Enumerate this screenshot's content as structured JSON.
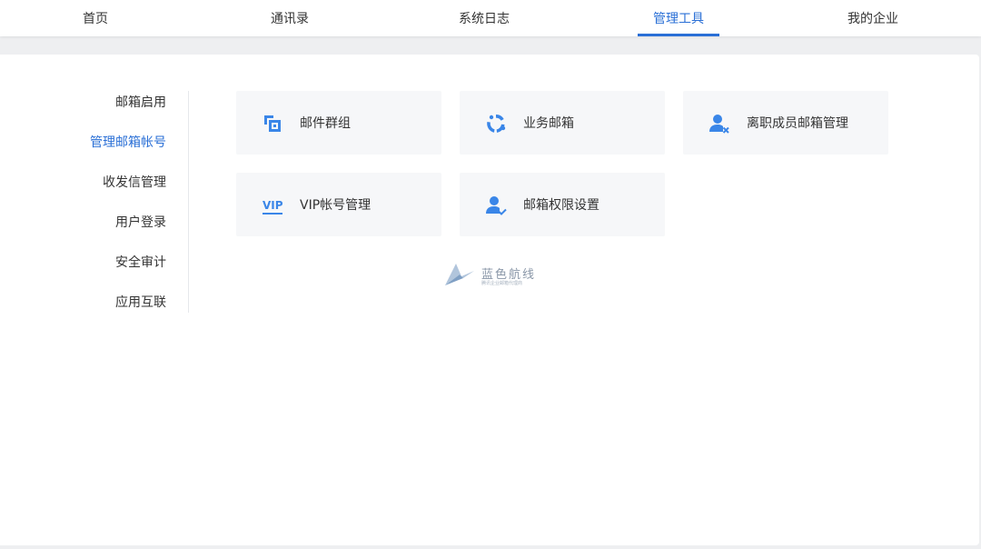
{
  "topnav": {
    "items": [
      {
        "label": "首页"
      },
      {
        "label": "通讯录"
      },
      {
        "label": "系统日志"
      },
      {
        "label": "管理工具",
        "active": true
      },
      {
        "label": "我的企业"
      }
    ]
  },
  "sidebar": {
    "items": [
      {
        "label": "邮箱启用"
      },
      {
        "label": "管理邮箱帐号",
        "active": true
      },
      {
        "label": "收发信管理"
      },
      {
        "label": "用户登录"
      },
      {
        "label": "安全审计"
      },
      {
        "label": "应用互联"
      }
    ]
  },
  "cards": [
    {
      "label": "邮件群组",
      "icon": "group-icon"
    },
    {
      "label": "业务邮箱",
      "icon": "business-mailbox-icon"
    },
    {
      "label": "离职成员邮箱管理",
      "icon": "user-remove-icon"
    },
    {
      "label": "VIP帐号管理",
      "icon": "vip-icon",
      "icon_text": "VIP"
    },
    {
      "label": "邮箱权限设置",
      "icon": "user-check-icon"
    }
  ],
  "watermark": {
    "title": "蓝色航线",
    "subtitle": "腾讯企业邮箱代理商"
  },
  "colors": {
    "accent": "#2a6fd6",
    "icon_blue": "#3a86e8",
    "card_bg": "#f6f7f9",
    "page_bg": "#eeeff1"
  }
}
